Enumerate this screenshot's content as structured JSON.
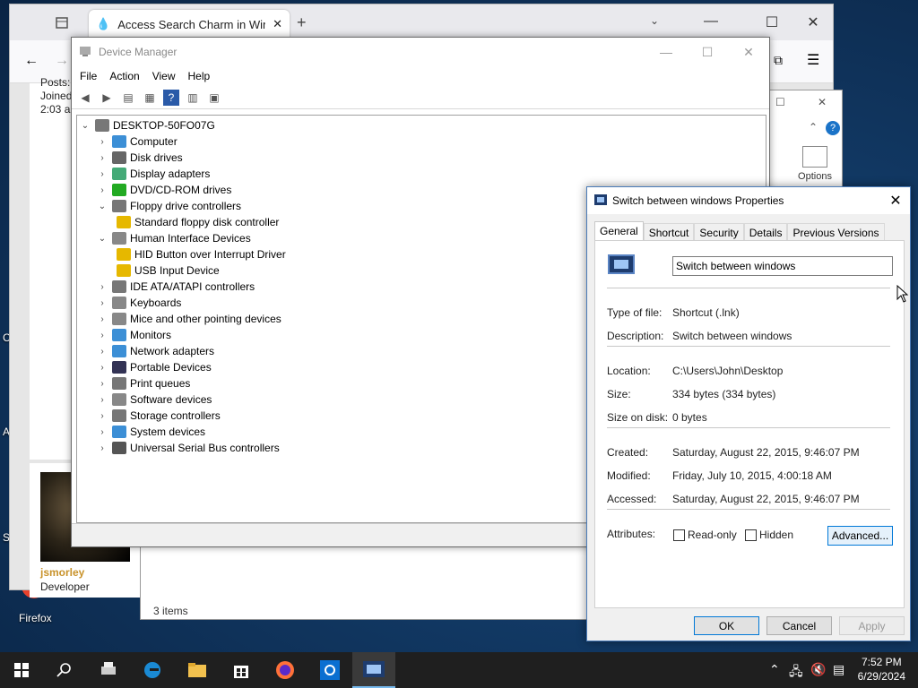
{
  "desktop": {
    "firefox_label": "Firefox",
    "edge_glyphs": [
      "C",
      "A",
      "S"
    ]
  },
  "browser": {
    "tab_title": "Access Search Charm in Windo",
    "forum": {
      "meta_lines": [
        "Posts:",
        "Joined",
        "2:03 a"
      ],
      "username": "jsmorley",
      "role": "Developer"
    }
  },
  "explorer": {
    "status": "3 items",
    "options_label": "Options"
  },
  "device_manager": {
    "title": "Device Manager",
    "menu": [
      "File",
      "Action",
      "View",
      "Help"
    ],
    "root": "DESKTOP-50FO07G",
    "tree": [
      {
        "label": "Computer",
        "level": 1,
        "expanded": false,
        "icon": "computer-icon",
        "color": "#3c8fd6"
      },
      {
        "label": "Disk drives",
        "level": 1,
        "expanded": false,
        "icon": "disk-drive-icon",
        "color": "#666"
      },
      {
        "label": "Display adapters",
        "level": 1,
        "expanded": false,
        "icon": "display-adapter-icon",
        "color": "#4a7"
      },
      {
        "label": "DVD/CD-ROM drives",
        "level": 1,
        "expanded": false,
        "icon": "dvd-drive-icon",
        "color": "#2a2"
      },
      {
        "label": "Floppy drive controllers",
        "level": 1,
        "expanded": true,
        "icon": "floppy-controller-icon",
        "color": "#777"
      },
      {
        "label": "Standard floppy disk controller",
        "level": 2,
        "expanded": null,
        "icon": "warning-device-icon",
        "color": "#e6b800"
      },
      {
        "label": "Human Interface Devices",
        "level": 1,
        "expanded": true,
        "icon": "hid-icon",
        "color": "#888"
      },
      {
        "label": "HID Button over Interrupt Driver",
        "level": 2,
        "expanded": null,
        "icon": "warning-device-icon",
        "color": "#e6b800"
      },
      {
        "label": "USB Input Device",
        "level": 2,
        "expanded": null,
        "icon": "warning-device-icon",
        "color": "#e6b800"
      },
      {
        "label": "IDE ATA/ATAPI controllers",
        "level": 1,
        "expanded": false,
        "icon": "ide-controller-icon",
        "color": "#777"
      },
      {
        "label": "Keyboards",
        "level": 1,
        "expanded": false,
        "icon": "keyboard-icon",
        "color": "#888"
      },
      {
        "label": "Mice and other pointing devices",
        "level": 1,
        "expanded": false,
        "icon": "mouse-icon",
        "color": "#888"
      },
      {
        "label": "Monitors",
        "level": 1,
        "expanded": false,
        "icon": "monitor-icon",
        "color": "#3c8fd6"
      },
      {
        "label": "Network adapters",
        "level": 1,
        "expanded": false,
        "icon": "network-adapter-icon",
        "color": "#3c8fd6"
      },
      {
        "label": "Portable Devices",
        "level": 1,
        "expanded": false,
        "icon": "portable-device-icon",
        "color": "#335"
      },
      {
        "label": "Print queues",
        "level": 1,
        "expanded": false,
        "icon": "printer-icon",
        "color": "#777"
      },
      {
        "label": "Software devices",
        "level": 1,
        "expanded": false,
        "icon": "software-device-icon",
        "color": "#888"
      },
      {
        "label": "Storage controllers",
        "level": 1,
        "expanded": false,
        "icon": "storage-controller-icon",
        "color": "#777"
      },
      {
        "label": "System devices",
        "level": 1,
        "expanded": false,
        "icon": "system-device-icon",
        "color": "#3c8fd6"
      },
      {
        "label": "Universal Serial Bus controllers",
        "level": 1,
        "expanded": false,
        "icon": "usb-icon",
        "color": "#555"
      }
    ]
  },
  "properties": {
    "title": "Switch between windows Properties",
    "tabs": [
      "General",
      "Shortcut",
      "Security",
      "Details",
      "Previous Versions"
    ],
    "active_tab": "General",
    "name": "Switch between windows",
    "type_label": "Type of file:",
    "type_value": "Shortcut (.lnk)",
    "description_label": "Description:",
    "description_value": "Switch between windows",
    "location_label": "Location:",
    "location_value": "C:\\Users\\John\\Desktop",
    "size_label": "Size:",
    "size_value": "334 bytes (334 bytes)",
    "size_on_disk_label": "Size on disk:",
    "size_on_disk_value": "0 bytes",
    "created_label": "Created:",
    "created_value": "Saturday, August 22, 2015, 9:46:07 PM",
    "modified_label": "Modified:",
    "modified_value": "Friday, July 10, 2015, 4:00:18 AM",
    "accessed_label": "Accessed:",
    "accessed_value": "Saturday, August 22, 2015, 9:46:07 PM",
    "attributes_label": "Attributes:",
    "readonly_label": "Read-only",
    "hidden_label": "Hidden",
    "advanced_label": "Advanced...",
    "ok_label": "OK",
    "cancel_label": "Cancel",
    "apply_label": "Apply"
  },
  "taskbar": {
    "time": "7:52 PM",
    "date": "6/29/2024"
  }
}
